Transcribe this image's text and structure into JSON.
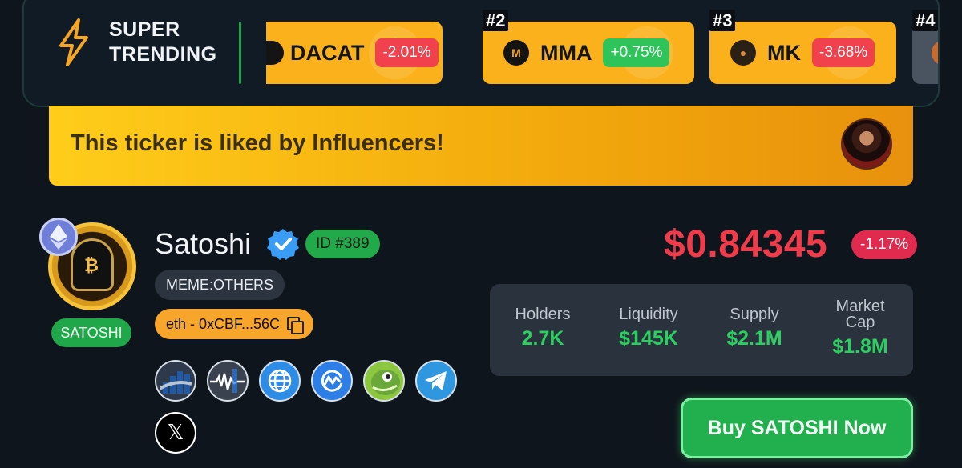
{
  "trending": {
    "title_line1": "SUPER",
    "title_line2": "TRENDING",
    "items": [
      {
        "rank": "",
        "name": "DACAT",
        "change": "-2.01%"
      },
      {
        "rank": "#2",
        "name": "MMA",
        "change": "+0.75%"
      },
      {
        "rank": "#3",
        "name": "MK",
        "change": "-3.68%"
      },
      {
        "rank": "#4",
        "name": "",
        "change": ""
      }
    ]
  },
  "banner": {
    "text": "This ticker is liked by Influencers!"
  },
  "token": {
    "name": "Satoshi",
    "id_label": "ID #389",
    "category": "MEME:OTHERS",
    "address": "eth - 0xCBF...56C",
    "symbol": "SATOSHI"
  },
  "price": {
    "value": "$0.84345",
    "change": "-1.17%"
  },
  "stats": [
    {
      "label": "Holders",
      "value": "2.7K"
    },
    {
      "label": "Liquidity",
      "value": "$145K"
    },
    {
      "label": "Supply",
      "value": "$2.1M"
    },
    {
      "label": "Market Cap",
      "value": "$1.8M"
    }
  ],
  "socials": [
    "dextools-icon",
    "chart-pulse-icon",
    "globe-icon",
    "coinmarketcap-icon",
    "coingecko-icon",
    "telegram-icon",
    "x-twitter-icon"
  ],
  "buy_button": "Buy SATOSHI Now",
  "colors": {
    "accent_green": "#21b04d",
    "price_red": "#ef3b4a",
    "trend_card": "#fbb11b",
    "background": "#0f151c"
  }
}
